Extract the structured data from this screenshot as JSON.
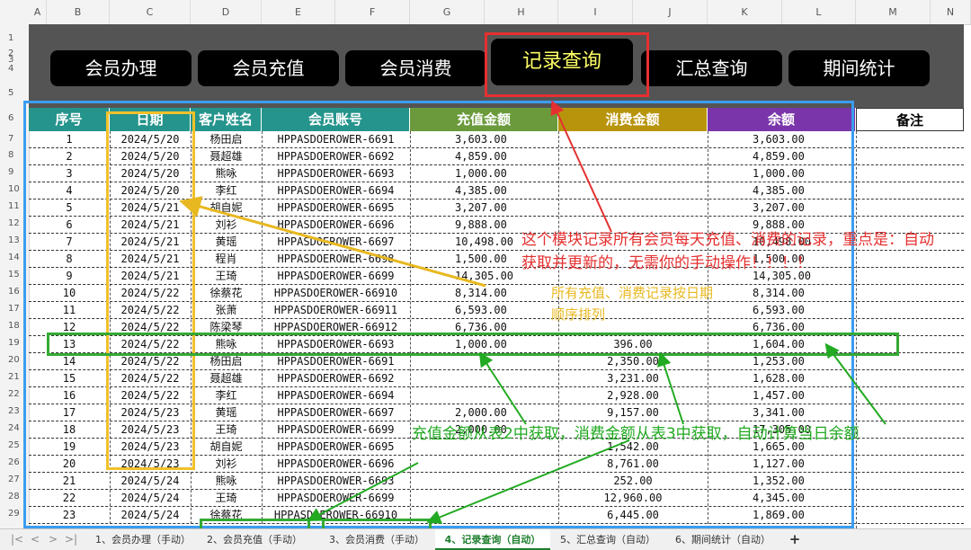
{
  "columns": [
    "A",
    "B",
    "C",
    "D",
    "E",
    "F",
    "G",
    "H",
    "I",
    "J",
    "K",
    "L",
    "M",
    "N"
  ],
  "row_numbers": [
    "1",
    "2",
    "3",
    "4",
    "5",
    "6",
    "7",
    "8",
    "9",
    "10",
    "11",
    "12",
    "13",
    "14",
    "15",
    "16",
    "17",
    "18",
    "19",
    "20",
    "21",
    "22",
    "23",
    "24",
    "25",
    "26",
    "27",
    "28",
    "29"
  ],
  "nav": [
    {
      "label": "会员办理"
    },
    {
      "label": "会员充值"
    },
    {
      "label": "会员消费"
    },
    {
      "label": "记录查询"
    },
    {
      "label": "汇总查询"
    },
    {
      "label": "期间统计"
    }
  ],
  "headers": {
    "seq": "序号",
    "date": "日期",
    "name": "客户姓名",
    "account": "会员账号",
    "recharge": "充值金额",
    "consume": "消费金额",
    "balance": "余额",
    "note": "备注"
  },
  "header_colors": {
    "teal": "#25948c",
    "green": "#6a9a3b",
    "gold": "#b8940c",
    "purple": "#7a35aa"
  },
  "rows": [
    {
      "seq": "1",
      "date": "2024/5/20",
      "name": "杨田启",
      "account": "HPPASDOEROWER-6691",
      "recharge": "3,603.00",
      "consume": "",
      "balance": "3,603.00"
    },
    {
      "seq": "2",
      "date": "2024/5/20",
      "name": "聂超雄",
      "account": "HPPASDOEROWER-6692",
      "recharge": "4,859.00",
      "consume": "",
      "balance": "4,859.00"
    },
    {
      "seq": "3",
      "date": "2024/5/20",
      "name": "熊咏",
      "account": "HPPASDOEROWER-6693",
      "recharge": "1,000.00",
      "consume": "",
      "balance": "1,000.00"
    },
    {
      "seq": "4",
      "date": "2024/5/20",
      "name": "李红",
      "account": "HPPASDOEROWER-6694",
      "recharge": "4,385.00",
      "consume": "",
      "balance": "4,385.00"
    },
    {
      "seq": "5",
      "date": "2024/5/21",
      "name": "胡自妮",
      "account": "HPPASDOEROWER-6695",
      "recharge": "3,207.00",
      "consume": "",
      "balance": "3,207.00"
    },
    {
      "seq": "6",
      "date": "2024/5/21",
      "name": "刘衫",
      "account": "HPPASDOEROWER-6696",
      "recharge": "9,888.00",
      "consume": "",
      "balance": "9,888.00"
    },
    {
      "seq": "7",
      "date": "2024/5/21",
      "name": "黄瑶",
      "account": "HPPASDOEROWER-6697",
      "recharge": "10,498.00",
      "consume": "",
      "balance": "10,498.00"
    },
    {
      "seq": "8",
      "date": "2024/5/21",
      "name": "程肖",
      "account": "HPPASDOEROWER-6698",
      "recharge": "1,500.00",
      "consume": "",
      "balance": "1,500.00"
    },
    {
      "seq": "9",
      "date": "2024/5/21",
      "name": "王琦",
      "account": "HPPASDOEROWER-6699",
      "recharge": "14,305.00",
      "consume": "",
      "balance": "14,305.00"
    },
    {
      "seq": "10",
      "date": "2024/5/22",
      "name": "徐蔡花",
      "account": "HPPASDOEROWER-66910",
      "recharge": "8,314.00",
      "consume": "",
      "balance": "8,314.00"
    },
    {
      "seq": "11",
      "date": "2024/5/22",
      "name": "张萧",
      "account": "HPPASDOEROWER-66911",
      "recharge": "6,593.00",
      "consume": "",
      "balance": "6,593.00"
    },
    {
      "seq": "12",
      "date": "2024/5/22",
      "name": "陈梁琴",
      "account": "HPPASDOEROWER-66912",
      "recharge": "6,736.00",
      "consume": "",
      "balance": "6,736.00"
    },
    {
      "seq": "13",
      "date": "2024/5/22",
      "name": "熊咏",
      "account": "HPPASDOEROWER-6693",
      "recharge": "1,000.00",
      "consume": "396.00",
      "balance": "1,604.00"
    },
    {
      "seq": "14",
      "date": "2024/5/22",
      "name": "杨田启",
      "account": "HPPASDOEROWER-6691",
      "recharge": "",
      "consume": "2,350.00",
      "balance": "1,253.00"
    },
    {
      "seq": "15",
      "date": "2024/5/22",
      "name": "聂超雄",
      "account": "HPPASDOEROWER-6692",
      "recharge": "",
      "consume": "3,231.00",
      "balance": "1,628.00"
    },
    {
      "seq": "16",
      "date": "2024/5/22",
      "name": "李红",
      "account": "HPPASDOEROWER-6694",
      "recharge": "",
      "consume": "2,928.00",
      "balance": "1,457.00"
    },
    {
      "seq": "17",
      "date": "2024/5/23",
      "name": "黄瑶",
      "account": "HPPASDOEROWER-6697",
      "recharge": "2,000.00",
      "consume": "9,157.00",
      "balance": "3,341.00"
    },
    {
      "seq": "18",
      "date": "2024/5/23",
      "name": "王琦",
      "account": "HPPASDOEROWER-6699",
      "recharge": "2,000.00",
      "consume": "",
      "balance": "17,305.00"
    },
    {
      "seq": "19",
      "date": "2024/5/23",
      "name": "胡自妮",
      "account": "HPPASDOEROWER-6695",
      "recharge": "",
      "consume": "1,542.00",
      "balance": "1,665.00"
    },
    {
      "seq": "20",
      "date": "2024/5/23",
      "name": "刘衫",
      "account": "HPPASDOEROWER-6696",
      "recharge": "",
      "consume": "8,761.00",
      "balance": "1,127.00"
    },
    {
      "seq": "21",
      "date": "2024/5/24",
      "name": "熊咏",
      "account": "HPPASDOEROWER-6693",
      "recharge": "",
      "consume": "252.00",
      "balance": "1,352.00"
    },
    {
      "seq": "22",
      "date": "2024/5/24",
      "name": "王琦",
      "account": "HPPASDOEROWER-6699",
      "recharge": "",
      "consume": "12,960.00",
      "balance": "4,345.00"
    },
    {
      "seq": "23",
      "date": "2024/5/24",
      "name": "徐蔡花",
      "account": "HPPASDOEROWER-66910",
      "recharge": "",
      "consume": "6,445.00",
      "balance": "1,869.00"
    }
  ],
  "annotations": {
    "red": "这个模块记录所有会员每天充值、消费的记录，重点是：自动获取并更新的，无需你的手动操作！！！！",
    "yellow": "所有充值、消费记录按日期顺序排列",
    "green": "充值金额从表2中获取，消费金额从表3中获取，自动计算当日余额"
  },
  "annotation_colors": {
    "red": "#e53030",
    "yellow": "#e8b820",
    "green": "#22aa22",
    "blue": "#3b9df0"
  },
  "tabs": [
    {
      "label": "1、会员办理（手动）"
    },
    {
      "label": "2、会员充值（手动）"
    },
    {
      "label": "3、会员消费（手动）"
    },
    {
      "label": "4、记录查询（自动）"
    },
    {
      "label": "5、汇总查询（自动）"
    },
    {
      "label": "6、期间统计（自动）"
    }
  ],
  "add_sheet": "+",
  "sheet_nav": [
    "|<",
    "<",
    ">",
    ">|"
  ]
}
